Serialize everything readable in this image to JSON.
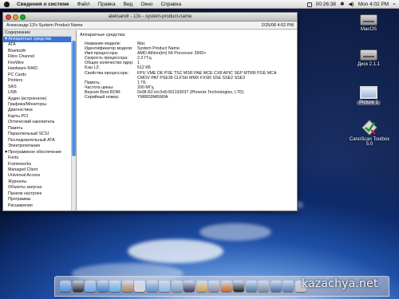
{
  "menubar": {
    "app_name": "Сведения о системе",
    "menus": [
      "Файл",
      "Правка",
      "Вид",
      "Окно",
      "Справка"
    ],
    "cpu_time": "00:26:38",
    "clock": "Mon 4:02 PM"
  },
  "window": {
    "title": "aleksandr - 13s - system-product-name",
    "computer_name": "Александр 13's System Product Name",
    "datetime": "2/25/08 4:02 PM"
  },
  "sidebar": {
    "header": "Содержание",
    "items": [
      {
        "label": "▼Аппаратные средства",
        "kind": "grp",
        "selected": true
      },
      {
        "label": "ATA",
        "kind": "sub"
      },
      {
        "label": "Bluetooth",
        "kind": "sub"
      },
      {
        "label": "Fibre Channel",
        "kind": "sub"
      },
      {
        "label": "FireWire",
        "kind": "sub"
      },
      {
        "label": "Hardware RAID",
        "kind": "sub"
      },
      {
        "label": "PC Cards",
        "kind": "sub"
      },
      {
        "label": "Printers",
        "kind": "sub"
      },
      {
        "label": "SAS",
        "kind": "sub"
      },
      {
        "label": "USB",
        "kind": "sub"
      },
      {
        "label": "Аудио (встроенное)",
        "kind": "sub"
      },
      {
        "label": "Графика/Мониторы",
        "kind": "sub"
      },
      {
        "label": "Диагностика",
        "kind": "sub"
      },
      {
        "label": "Карты PCI",
        "kind": "sub"
      },
      {
        "label": "Оптический накопитель",
        "kind": "sub"
      },
      {
        "label": "Память",
        "kind": "sub"
      },
      {
        "label": "Параллельный SCSI",
        "kind": "sub"
      },
      {
        "label": "Последовательный ATA",
        "kind": "sub"
      },
      {
        "label": "Электропитание",
        "kind": "sub"
      },
      {
        "label": "▼Программное обеспечение",
        "kind": "grp"
      },
      {
        "label": "Fonts",
        "kind": "sub"
      },
      {
        "label": "Frameworks",
        "kind": "sub"
      },
      {
        "label": "Managed Client",
        "kind": "sub"
      },
      {
        "label": "Universal Access",
        "kind": "sub"
      },
      {
        "label": "Журналы",
        "kind": "sub"
      },
      {
        "label": "Объекты запуска",
        "kind": "sub"
      },
      {
        "label": "Панели настроек",
        "kind": "sub"
      },
      {
        "label": "Программы",
        "kind": "sub"
      },
      {
        "label": "Расширения",
        "kind": "sub"
      }
    ]
  },
  "detail": {
    "heading": "Аппаратные средства:",
    "properties": [
      {
        "key": "Название модели:",
        "value": "Mac"
      },
      {
        "key": "Идентификатор модели:",
        "value": "System Product Name"
      },
      {
        "key": "Имя процессора:",
        "value": "AMD Athlon(tm) 64 Processor 3500+"
      },
      {
        "key": "Скорость процессора:",
        "value": "2.2 ГГц"
      },
      {
        "key": "Общее количество ядер:",
        "value": "1"
      },
      {
        "key": "Кэш L2:",
        "value": "512 КБ"
      },
      {
        "key": "Свойства процессора:",
        "value": "FPU VME DE PSE TSC MSR PAE MCE CX8 APIC SEP MTRR PGE MCA"
      },
      {
        "key": "",
        "value": "CMOV PAT PSE36 CLFSH MMX FXSR SSE SSE2 SSE3"
      },
      {
        "key": "Память:",
        "value": "1 ГБ"
      },
      {
        "key": "Частота шины:",
        "value": "200 МГц"
      },
      {
        "key": "Версия Boot ROM:",
        "value": "0x08.R2.int.0x8.061193037 (Phoenix Technologies, LTD)"
      },
      {
        "key": "Серийный номер:",
        "value": "YM8659M6W0A"
      }
    ]
  },
  "desktop": {
    "icons": [
      {
        "name": "MacOS",
        "type": "disk"
      },
      {
        "name": "Диск 2.1.1",
        "type": "disk"
      },
      {
        "name": "Picture 1",
        "type": "picture"
      },
      {
        "name": "CanoScan Toolbox 5.0",
        "type": "app"
      }
    ]
  },
  "dock": {
    "items": [
      "finder",
      "dashboard",
      "mail",
      "safari",
      "ichat",
      "address-book",
      "ical",
      "preview",
      "itunes",
      "iphoto",
      "imovie",
      "garageband",
      "system-preferences",
      "firefox",
      "terminal",
      "activity-monitor",
      "system-profiler",
      "applications-folder",
      "documents-folder",
      "trash"
    ]
  },
  "watermark": "kazachya.net"
}
